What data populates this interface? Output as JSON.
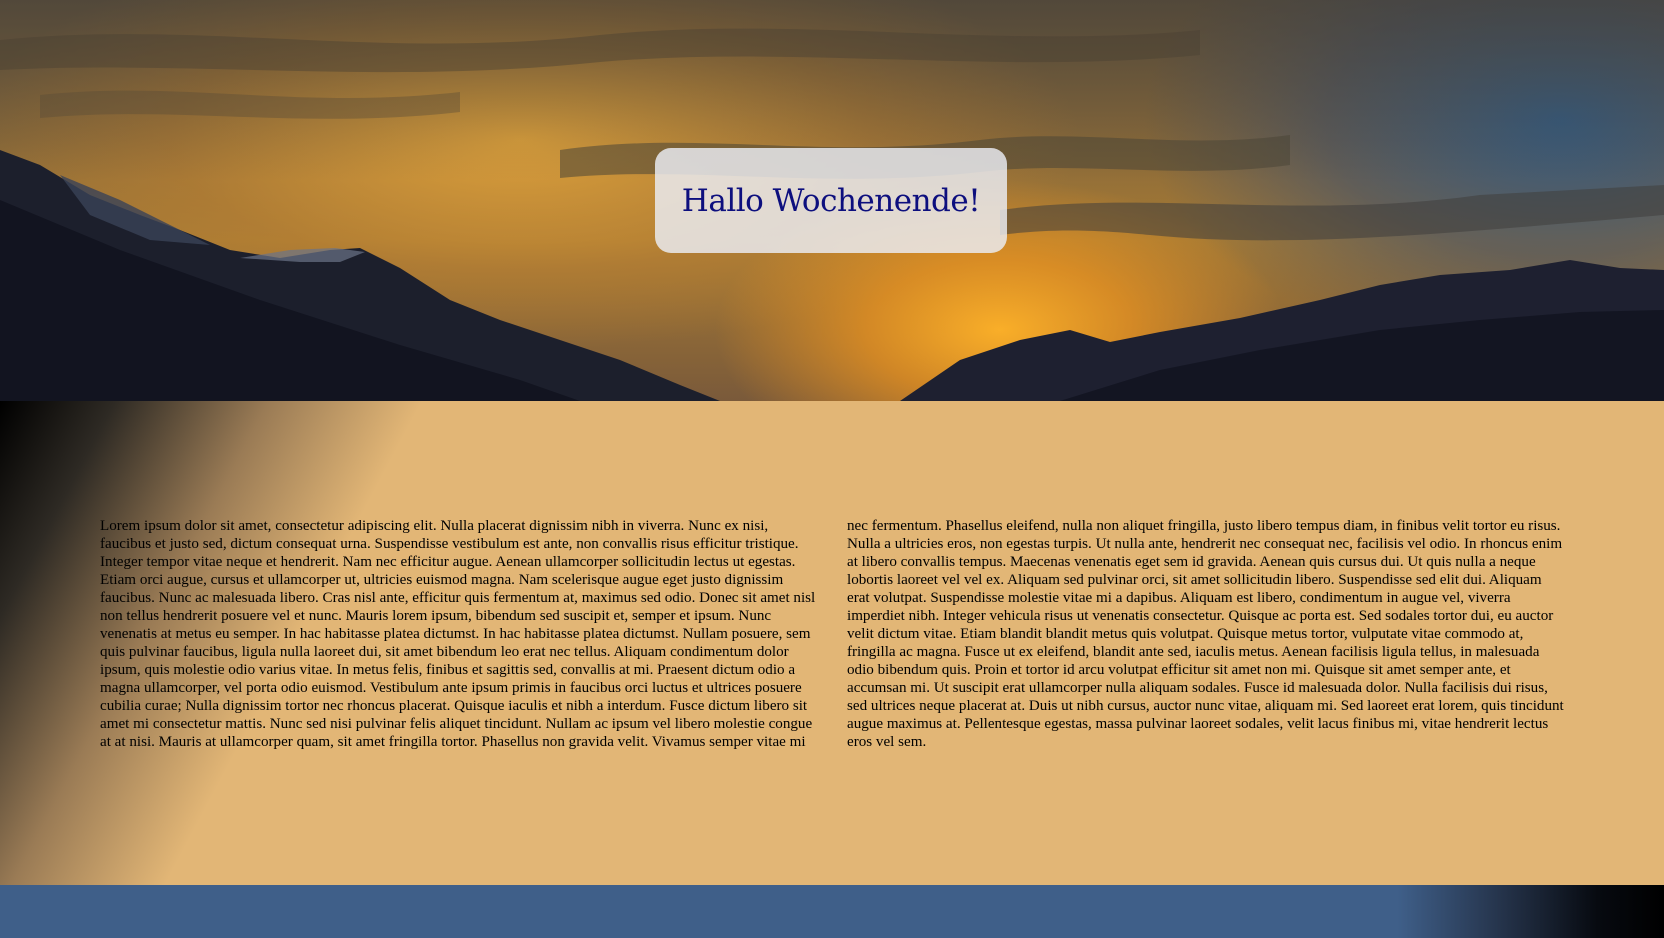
{
  "hero": {
    "title": "Hallo Wochenende!"
  },
  "content": {
    "text": "Lorem ipsum dolor sit amet, consectetur adipiscing elit. Nulla placerat dignissim nibh in viverra. Nunc ex nisi, faucibus et justo sed, dictum consequat urna. Suspendisse vestibulum est ante, non convallis risus efficitur tristique. Integer tempor vitae neque et hendrerit. Nam nec efficitur augue. Aenean ullamcorper sollicitudin lectus ut egestas. Etiam orci augue, cursus et ullamcorper ut, ultricies euismod magna. Nam scelerisque augue eget justo dignissim faucibus. Nunc ac malesuada libero. Cras nisl ante, efficitur quis fermentum at, maximus sed odio. Donec sit amet nisl non tellus hendrerit posuere vel et nunc. Mauris lorem ipsum, bibendum sed suscipit et, semper et ipsum. Nunc venenatis at metus eu semper. In hac habitasse platea dictumst. In hac habitasse platea dictumst. Nullam posuere, sem quis pulvinar faucibus, ligula nulla laoreet dui, sit amet bibendum leo erat nec tellus. Aliquam condimentum dolor ipsum, quis molestie odio varius vitae. In metus felis, finibus et sagittis sed, convallis at mi. Praesent dictum odio a magna ullamcorper, vel porta odio euismod. Vestibulum ante ipsum primis in faucibus orci luctus et ultrices posuere cubilia curae; Nulla dignissim tortor nec rhoncus placerat. Quisque iaculis et nibh a interdum. Fusce dictum libero sit amet mi consectetur mattis. Nunc sed nisi pulvinar felis aliquet tincidunt. Nullam ac ipsum vel libero molestie congue at at nisi. Mauris at ullamcorper quam, sit amet fringilla tortor. Phasellus non gravida velit. Vivamus semper vitae mi nec fermentum. Phasellus eleifend, nulla non aliquet fringilla, justo libero tempus diam, in finibus velit tortor eu risus. Nulla a ultricies eros, non egestas turpis. Ut nulla ante, hendrerit nec consequat nec, facilisis vel odio. In rhoncus enim at libero convallis tempus. Maecenas venenatis eget sem id gravida. Aenean quis cursus dui. Ut quis nulla a neque lobortis laoreet vel vel ex. Aliquam sed pulvinar orci, sit amet sollicitudin libero. Suspendisse sed elit dui. Aliquam erat volutpat. Suspendisse molestie vitae mi a dapibus. Aliquam est libero, condimentum in augue vel, viverra imperdiet nibh. Integer vehicula risus ut venenatis consectetur. Quisque ac porta est. Sed sodales tortor dui, eu auctor velit dictum vitae. Etiam blandit blandit metus quis volutpat. Quisque metus tortor, vulputate vitae commodo at, fringilla ac magna. Fusce ut ex eleifend, blandit ante sed, iaculis metus. Aenean facilisis ligula tellus, in malesuada odio bibendum quis. Proin et tortor id arcu volutpat efficitur sit amet non mi. Quisque sit amet semper ante, et accumsan mi. Ut suscipit erat ullamcorper nulla aliquam sodales. Fusce id malesuada dolor. Nulla facilisis dui risus, sed ultrices neque placerat at. Duis ut nibh cursus, auctor nunc vitae, aliquam mi. Sed laoreet erat lorem, quis tincidunt augue maximus at. Pellentesque egestas, massa pulvinar laoreet sodales, velit lacus finibus mi, vitae hendrerit lectus eros vel sem."
  },
  "colors": {
    "title": "#0d0f7e",
    "content_background": "#e2b676",
    "footer_background": "#3f5f89"
  },
  "icons": {
    "hero_image": "sunset-mountains-image"
  }
}
